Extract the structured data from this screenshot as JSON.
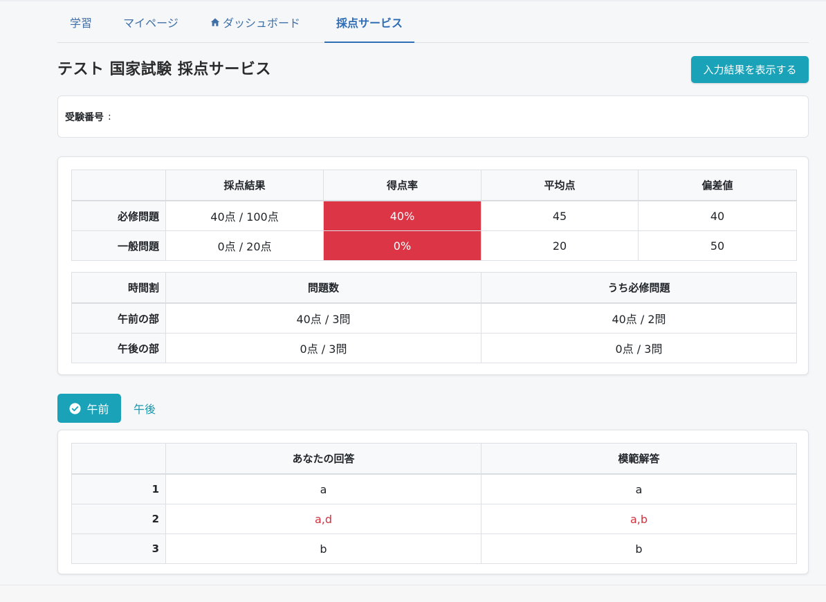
{
  "nav": {
    "items": [
      {
        "label": "学習"
      },
      {
        "label": "マイページ"
      },
      {
        "label": "ダッシュボード",
        "icon": "home-icon"
      },
      {
        "label": "採点サービス",
        "active": true
      }
    ]
  },
  "header": {
    "title": "テスト 国家試験 採点サービス",
    "show_results_label": "入力結果を表示する"
  },
  "exam": {
    "label": "受験番号",
    "colon": ":",
    "value": ""
  },
  "score_table": {
    "headers": [
      "",
      "採点結果",
      "得点率",
      "平均点",
      "偏差値"
    ],
    "rows": [
      {
        "label": "必修問題",
        "result": "40点 / 100点",
        "rate": "40%",
        "average": "45",
        "deviation": "40"
      },
      {
        "label": "一般問題",
        "result": "0点 / 20点",
        "rate": "0%",
        "average": "20",
        "deviation": "50"
      }
    ]
  },
  "time_table": {
    "headers": [
      "時間割",
      "問題数",
      "うち必修問題"
    ],
    "rows": [
      {
        "label": "午前の部",
        "count": "40点 / 3問",
        "required": "40点 / 2問"
      },
      {
        "label": "午後の部",
        "count": "0点 / 3問",
        "required": "0点 / 3問"
      }
    ]
  },
  "tabs": {
    "am_label": "午前",
    "pm_label": "午後"
  },
  "answers_table": {
    "headers": [
      "",
      "あなたの回答",
      "模範解答"
    ],
    "rows": [
      {
        "no": "1",
        "yours": "a",
        "model": "a"
      },
      {
        "no": "2",
        "yours": "a,d",
        "model": "a,b"
      },
      {
        "no": "3",
        "yours": "b",
        "model": "b"
      }
    ]
  },
  "colors": {
    "accent": "#1aa2b8",
    "nav_link": "#3f6fa6",
    "fail": "#dc3545",
    "wrong_answer": "#d0333f"
  }
}
